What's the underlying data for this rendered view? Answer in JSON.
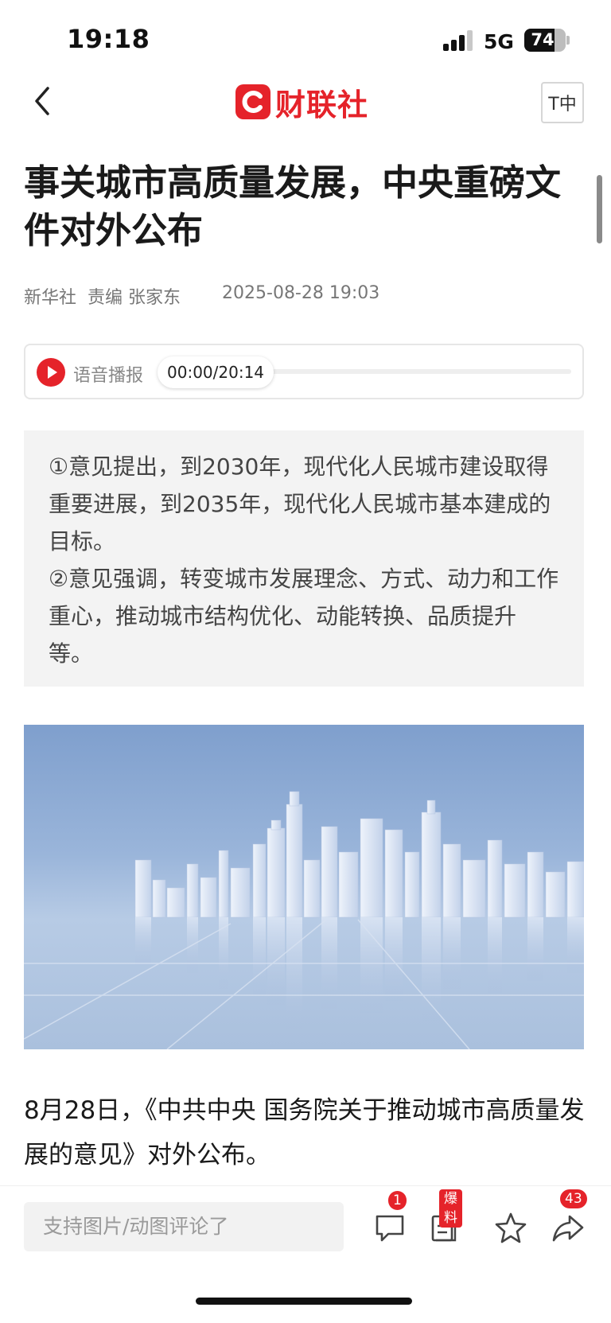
{
  "status_bar": {
    "time": "19:18",
    "network": "5G",
    "battery": "74"
  },
  "header": {
    "brand": "财联社",
    "font_size_button": "T中"
  },
  "article": {
    "title": "事关城市高质量发展，中央重磅文件对外公布",
    "source": "新华社",
    "editor": "责编 张家东",
    "date": "2025-08-28 19:03",
    "audio": {
      "label": "语音播报",
      "time": "00:00/20:14"
    },
    "summary": [
      "①意见提出，到2030年，现代化人民城市建设取得重要进展，到2035年，现代化人民城市基本建成的目标。",
      "②意见强调，转变城市发展理念、方式、动力和工作重心，推动城市结构优化、动能转换、品质提升等。"
    ],
    "body": "8月28日，《中共中央 国务院关于推动城市高质量发展的意见》对外公布。"
  },
  "bottom_bar": {
    "comment_placeholder": "支持图片/动图评论了",
    "comment_count": "1",
    "tip_label": "爆料",
    "share_count": "43"
  },
  "colors": {
    "brand_red": "#e5232a",
    "summary_bg": "#f3f3f3"
  }
}
